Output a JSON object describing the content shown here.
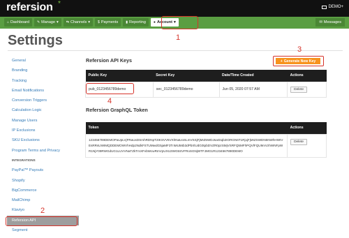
{
  "brand": {
    "logo": "refersion",
    "star": "*"
  },
  "user": {
    "label": "DEMO+"
  },
  "nav": [
    {
      "label": "Dashboard",
      "icon": "home-icon",
      "glyph": "⌂"
    },
    {
      "label": "Manage",
      "icon": "edit-icon",
      "glyph": "✎",
      "caret": "▾"
    },
    {
      "label": "Channels",
      "icon": "channels-icon",
      "glyph": "⇆",
      "caret": "▾"
    },
    {
      "label": "Payments",
      "icon": "payments-icon",
      "glyph": "$"
    },
    {
      "label": "Reporting",
      "icon": "chart-icon",
      "glyph": "▮"
    },
    {
      "label": "Account",
      "icon": "user-icon",
      "glyph": "●",
      "caret": "▾",
      "active": true
    }
  ],
  "messages": {
    "label": "Messages",
    "glyph": "✉"
  },
  "page_title": "Settings",
  "callouts": {
    "one": "1",
    "two": "2",
    "three": "3",
    "four": "4"
  },
  "sidebar": {
    "items": [
      "General",
      "Branding",
      "Tracking",
      "Email Notifications",
      "Conversion Triggers",
      "Calculation Logic",
      "Manage Users",
      "IP Exclusions",
      "SKU Exclusions",
      "Program Terms and Privacy"
    ],
    "section": "INTEGRATIONS",
    "integrations": [
      "PayPal™ Payouts",
      "Shopify",
      "BigCommerce",
      "MailChimp",
      "Klaviyo",
      "Refersion API",
      "Segment"
    ],
    "active": "Refersion API"
  },
  "api_keys": {
    "title": "Refersion API Keys",
    "generate_label": "Generate New Key",
    "generate_glyph": "+",
    "columns": [
      "Public Key",
      "Secret Key",
      "Date/Time Created",
      "Actions"
    ],
    "rows": [
      {
        "public_key": "pub_0123456789demo",
        "secret_key": "sec_0123456789demo",
        "created": "Jun 05, 2020 07:57 AM",
        "action": "Delete"
      }
    ]
  },
  "graphql": {
    "title": "Refersion GraphQL Token",
    "columns": [
      "Token",
      "Actions"
    ],
    "token": "123456789DEMOPaUpLVjFRaUxDSmhRDNpT2tKSVV6VXhNaUoSLmVSSjFjMIZ5WDJsaGtqb2IORGN6T1RjxjFjMIZSWDN5NWhHWIVEsRRsUWIMQDDEMOWVhHdp2NdkFSTUMwdG5jaMF3TnMU56b3dPbXlUdG0tpbDVZR0pzSMjVSRFQ5MFhPQVlFQU9mVzhWNFpWR1NjY09RWGdUG1LUVVNaTZkTmXFvbWcwRmVpUXU2WG5SVFRoSGNjWTFJMG1R1234567890DEMO",
    "action": "Delete"
  },
  "colors": {
    "accent": "#f7931e",
    "nav_green": "#5a9e42",
    "callout": "#d6332a",
    "link": "#337ab7"
  }
}
